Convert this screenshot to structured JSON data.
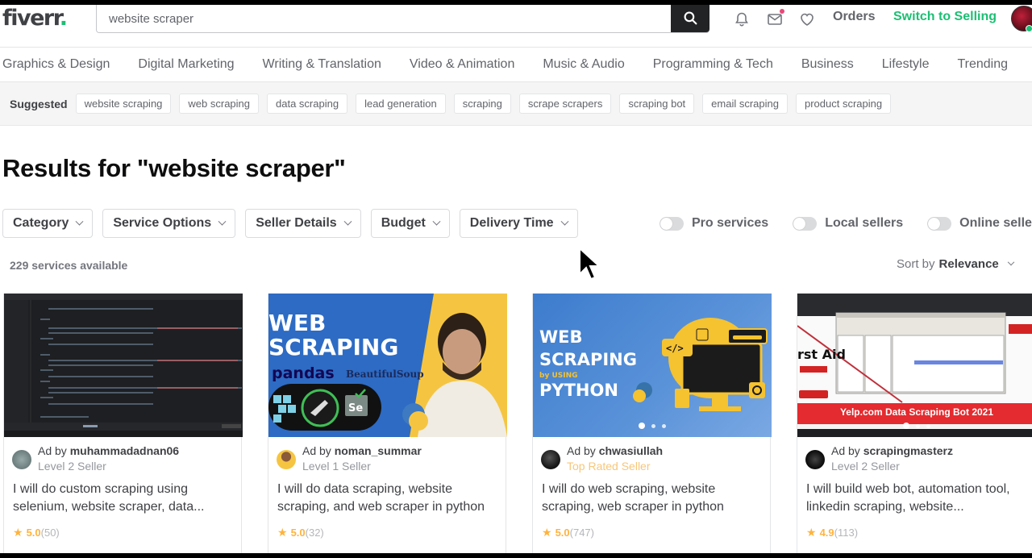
{
  "header": {
    "logo": "fiverr",
    "logo_dot": ".",
    "search_value": "website scraper",
    "orders_label": "Orders",
    "switch_label": "Switch to Selling",
    "icons": [
      "bell-icon",
      "mail-icon",
      "heart-icon"
    ],
    "brand_color": "#1dbf73"
  },
  "categories": [
    "Graphics & Design",
    "Digital Marketing",
    "Writing & Translation",
    "Video & Animation",
    "Music & Audio",
    "Programming & Tech",
    "Business",
    "Lifestyle",
    "Trending"
  ],
  "suggested": {
    "label": "Suggested",
    "items": [
      "website scraping",
      "web scraping",
      "data scraping",
      "lead generation",
      "scraping",
      "scrape scrapers",
      "scraping bot",
      "email scraping",
      "product scraping"
    ]
  },
  "results": {
    "title": "Results for \"website scraper\"",
    "count": "229 services available",
    "sort_label": "Sort by",
    "sort_value": "Relevance"
  },
  "filters": [
    "Category",
    "Service Options",
    "Seller Details",
    "Budget",
    "Delivery Time"
  ],
  "toggles": [
    {
      "label": "Pro services",
      "on": false
    },
    {
      "label": "Local sellers",
      "on": false
    },
    {
      "label": "Online sellers",
      "on": false
    }
  ],
  "gigs": [
    {
      "ad_prefix": "Ad by",
      "seller": "muhammadadnan06",
      "level": "Level 2 Seller",
      "title": "I will do custom scraping using selenium, website scraper, data...",
      "score": "5.0",
      "reviews": "(50)"
    },
    {
      "ad_prefix": "Ad by",
      "seller": "noman_summar",
      "level": "Level 1 Seller",
      "title": "I will do data scraping, website scraping, and web scraper in python",
      "score": "5.0",
      "reviews": "(32)",
      "thumb_text": [
        "WEB",
        "SCRAPING",
        "pandas",
        "BeautifulSoup"
      ]
    },
    {
      "ad_prefix": "Ad by",
      "seller": "chwasiullah",
      "level": "Top Rated Seller",
      "title": "I will do web scraping, website scraping, web scraper in python",
      "score": "5.0",
      "reviews": "(747)",
      "thumb_text": [
        "WEB",
        "SCRAPING",
        "by USING",
        "PYTHON"
      ]
    },
    {
      "ad_prefix": "Ad by",
      "seller": "scrapingmasterz",
      "level": "Level 2 Seller",
      "title": "I will build web bot, automation tool, linkedin scraping, website...",
      "score": "4.9",
      "reviews": "(113)",
      "thumb_text": [
        "rst Aid",
        "Yelp.com Data Scraping Bot 2021"
      ]
    }
  ]
}
